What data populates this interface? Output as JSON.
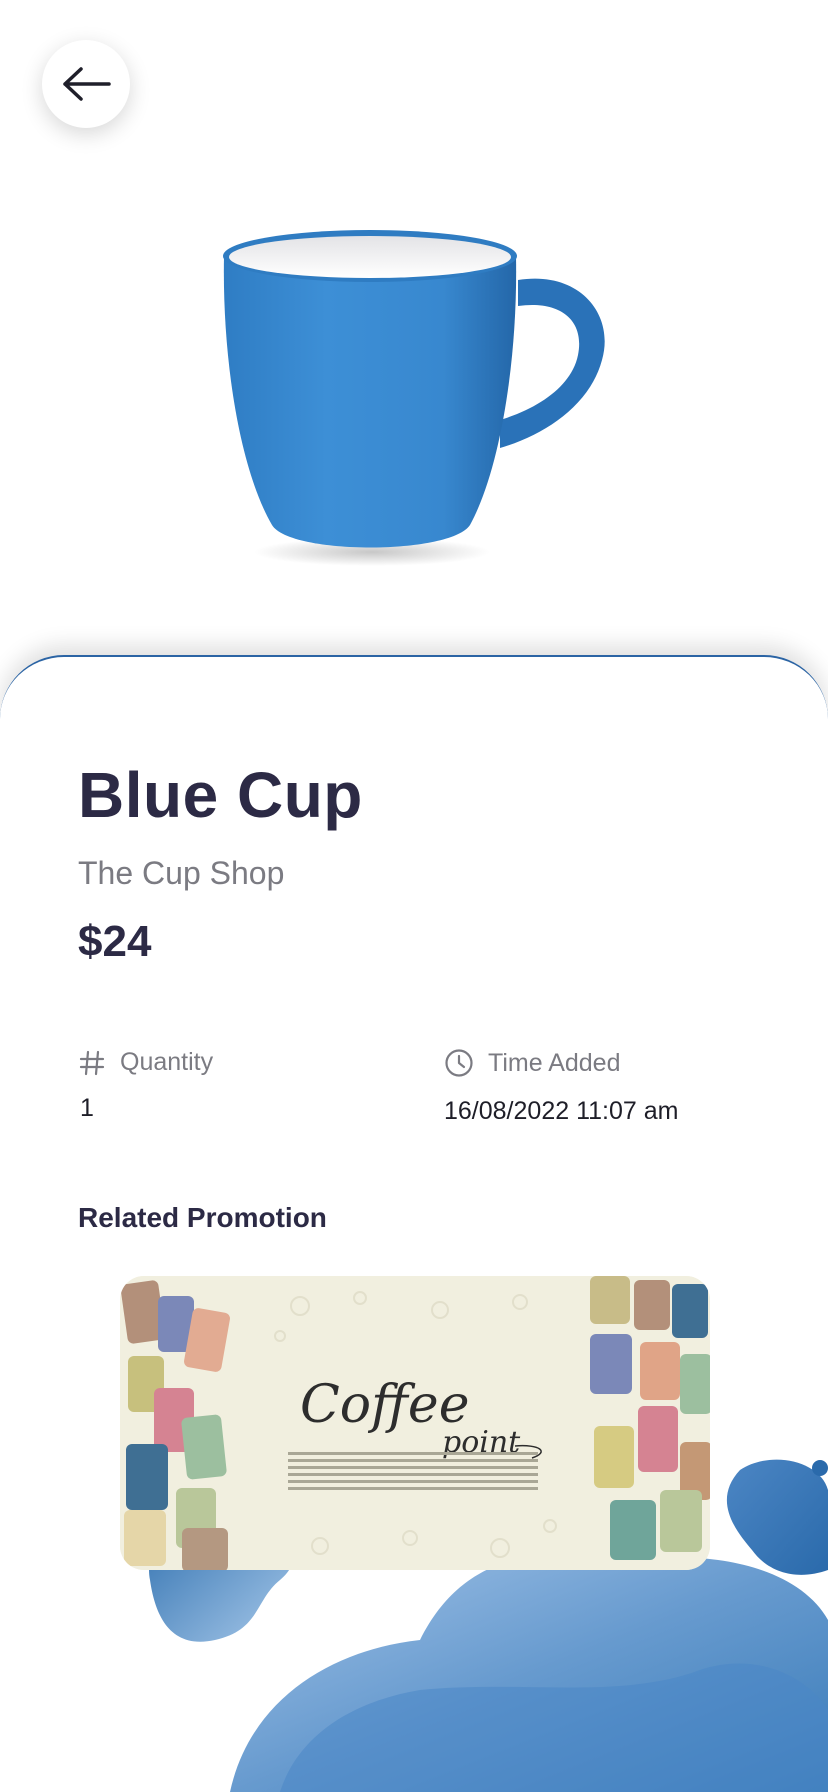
{
  "product": {
    "title": "Blue Cup",
    "shop": "The Cup Shop",
    "price": "$24",
    "image_icon": "blue-mug"
  },
  "meta": {
    "quantity_label": "Quantity",
    "quantity_value": "1",
    "quantity_icon": "hash-icon",
    "time_label": "Time Added",
    "time_value": "16/08/2022 11:07 am",
    "time_icon": "clock-icon"
  },
  "promotion": {
    "section_title": "Related Promotion",
    "banner_title": "Coffee",
    "banner_subtitle": "point"
  },
  "colors": {
    "accent": "#2b64a4",
    "mug_blue": "#3a8ad0",
    "text_dark": "#2c2a45",
    "text_muted": "#7b7b82",
    "promo_bg": "#f1efdf"
  }
}
